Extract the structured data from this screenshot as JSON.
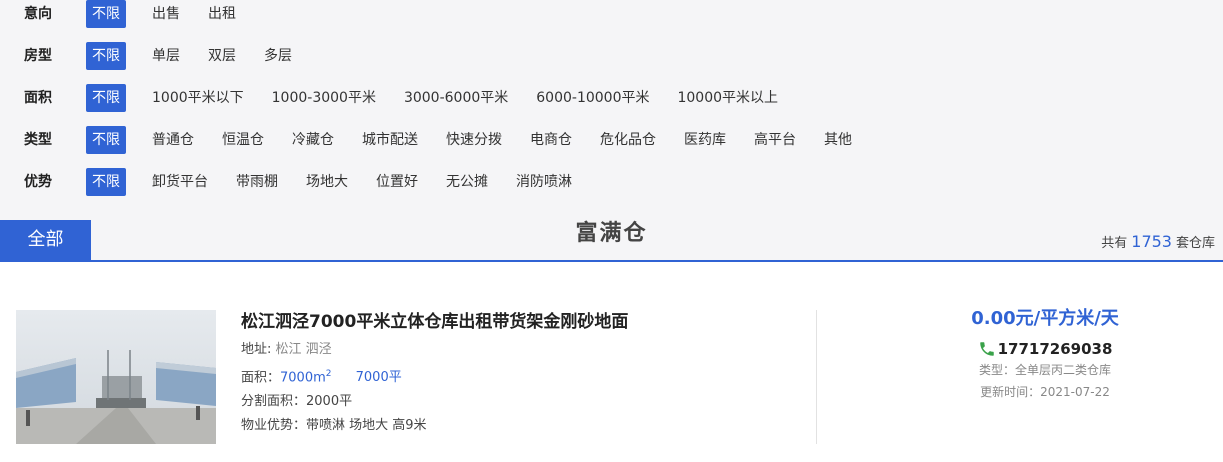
{
  "filters": [
    {
      "label": "意向",
      "options": [
        "不限",
        "出售",
        "出租"
      ]
    },
    {
      "label": "房型",
      "options": [
        "不限",
        "单层",
        "双层",
        "多层"
      ]
    },
    {
      "label": "面积",
      "options": [
        "不限",
        "1000平米以下",
        "1000-3000平米",
        "3000-6000平米",
        "6000-10000平米",
        "10000平米以上"
      ]
    },
    {
      "label": "类型",
      "options": [
        "不限",
        "普通仓",
        "恒温仓",
        "冷藏仓",
        "城市配送",
        "快速分拨",
        "电商仓",
        "危化品仓",
        "医药库",
        "高平台",
        "其他"
      ]
    },
    {
      "label": "优势",
      "options": [
        "不限",
        "卸货平台",
        "带雨棚",
        "场地大",
        "位置好",
        "无公摊",
        "消防喷淋"
      ]
    }
  ],
  "tabbar": {
    "all_tab": "全部",
    "title": "富满仓",
    "count_prefix": "共有",
    "count": "1753",
    "count_suffix": "套仓库"
  },
  "listing": {
    "title": "松江泗泾7000平米立体仓库出租带货架金刚砂地面",
    "address_label": "地址:",
    "address": "松江 泗泾",
    "area_label": "面积：",
    "area_value": "7000m",
    "area_sup": "2",
    "area_alt": "7000平",
    "split_label": "分割面积：",
    "split_value": "2000平",
    "adv_label": "物业优势：",
    "adv_value": "带喷淋 场地大 高9米",
    "price": "0.00元/平方米/天",
    "phone": "17717269038",
    "type": "类型：全单层丙二类仓库",
    "updated": "更新时间：2021-07-22"
  },
  "colors": {
    "accent": "#3063d4"
  }
}
